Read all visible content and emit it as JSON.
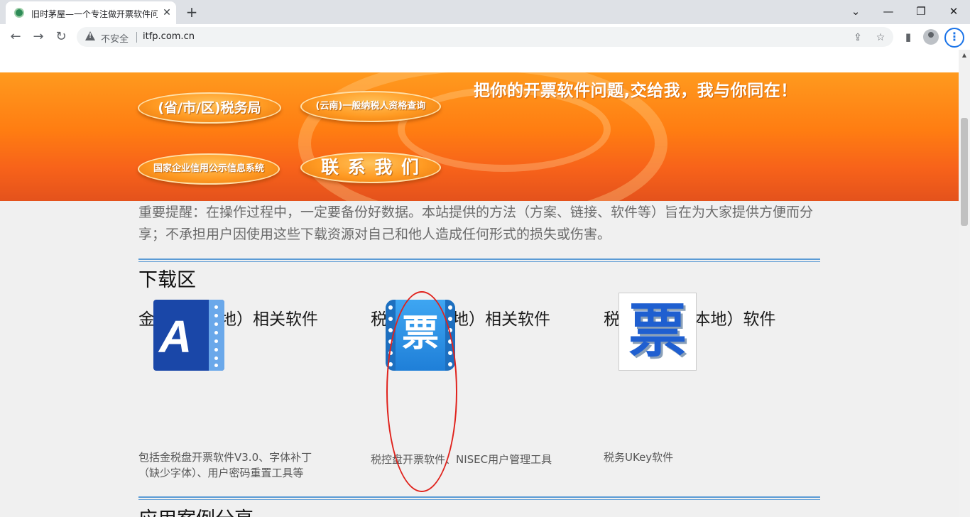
{
  "browser": {
    "tab_title": "旧时茅屋—一个专注做开票软件问题的网站",
    "tab_close": "✕",
    "new_tab": "+",
    "window_controls": {
      "dropdown": "⌄",
      "minimize": "—",
      "restore": "❐",
      "close": "✕"
    },
    "nav": {
      "back": "←",
      "forward": "→",
      "reload": "↻"
    },
    "security_label": "不安全",
    "url": "itfp.com.cn",
    "icons": {
      "share": "⇪",
      "bookmark": "☆",
      "sidebar": "▮",
      "menu": "⋮"
    }
  },
  "banner": {
    "slogan": "把你的开票软件问题,交给我，我与你同在！",
    "buttons": [
      {
        "label": "(省/市/区)税务局"
      },
      {
        "label": "(云南)一般纳税人资格查询"
      },
      {
        "label": "国家企业信用公示信息系统"
      },
      {
        "label": "联 系 我 们"
      }
    ]
  },
  "notice": {
    "text": "重要提醒：在操作过程中，一定要备份好数据。本站提供的方法（方案、链接、软件等）旨在为大家提供方便而分享；不承担用户因使用这些下载资源对自己和他人造成任何形式的损失或伤害。"
  },
  "downloads": {
    "title": "下载区",
    "categories": [
      {
        "title": "金税盘（本地）相关软件",
        "icon": "golden-tax-disk-icon",
        "icon_letter": "A",
        "description": "包括金税盘开票软件V3.0、字体补丁（缺少字体）、用户密码重置工具等"
      },
      {
        "title": "税控盘（本地）相关软件",
        "icon": "tax-control-disk-icon",
        "icon_glyph": "票",
        "description": "税控盘开票软件、NISEC用户管理工具"
      },
      {
        "title": "税务UKey（本地）软件",
        "icon": "tax-ukey-icon",
        "icon_glyph": "票",
        "description": "税务UKey软件"
      }
    ]
  },
  "next_section": {
    "title": "应用案例分享"
  },
  "colors": {
    "banner_orange": "#ff8a1a",
    "divider_blue": "#5b9bd5",
    "annotation_red": "#e0221c",
    "tab_icon_blue": "#1f7fd8"
  }
}
